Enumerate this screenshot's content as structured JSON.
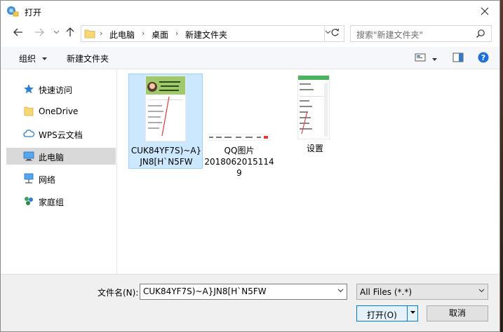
{
  "window": {
    "title": "打开"
  },
  "address": {
    "crumbs": [
      "此电脑",
      "桌面",
      "新建文件夹"
    ]
  },
  "search": {
    "placeholder": "搜索\"新建文件夹\""
  },
  "toolbar": {
    "organize": "组织",
    "new_folder": "新建文件夹"
  },
  "sidebar": {
    "items": [
      {
        "label": "快速访问",
        "icon": "star-icon"
      },
      {
        "label": "OneDrive",
        "icon": "folder-icon"
      },
      {
        "label": "WPS云文档",
        "icon": "cloud-icon"
      },
      {
        "label": "此电脑",
        "icon": "computer-icon"
      },
      {
        "label": "网络",
        "icon": "network-icon"
      },
      {
        "label": "家庭组",
        "icon": "homegroup-icon"
      }
    ],
    "selected_index": 3
  },
  "files": [
    {
      "name_line1": "CUK84YF7S)~A}",
      "name_line2": "JN8[H`N5FW",
      "selected": true
    },
    {
      "name_line1": "QQ图片",
      "name_line2": "2018062015114",
      "name_line3": "9",
      "selected": false
    },
    {
      "name_line1": "设置",
      "selected": false
    }
  ],
  "bottom": {
    "filename_label": "文件名(N):",
    "filename_value": "CUK84YF7S)~A}JN8[H`N5FW",
    "filetype_value": "All Files (*.*)",
    "open_label": "打开(O)",
    "cancel_label": "取消"
  },
  "colors": {
    "accent": "#0078d7",
    "selection": "#cce8ff",
    "help": "#1e6fd9"
  }
}
